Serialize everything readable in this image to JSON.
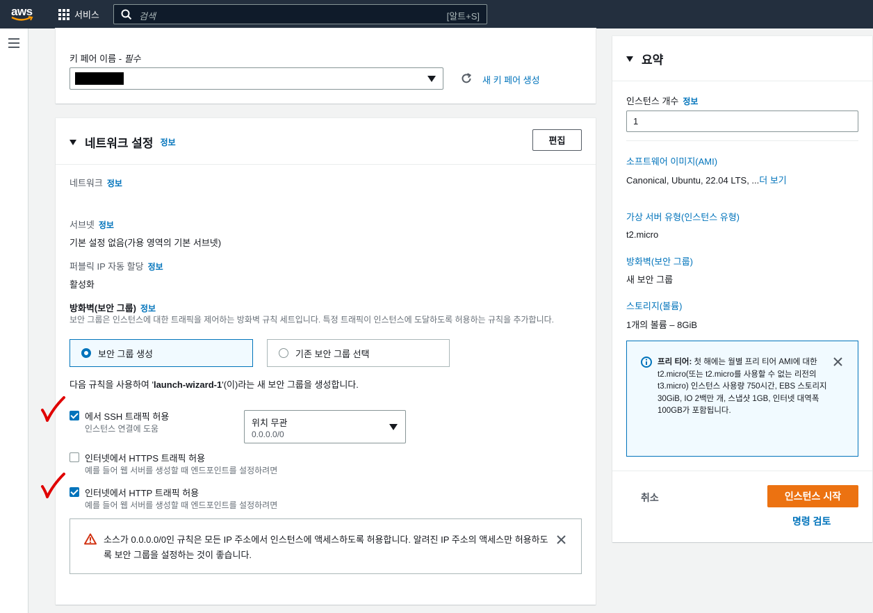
{
  "topbar": {
    "logo_text": "aws",
    "services_label": "서비스",
    "search_placeholder": "검색",
    "search_shortcut": "[알트+S]"
  },
  "keypair": {
    "label": "키 페어 이름",
    "required": " - 필수",
    "new_link": "새 키 페어 생성"
  },
  "network": {
    "title": "네트워크 설정",
    "info": "정보",
    "edit_button": "편집",
    "network_label": "네트워크",
    "subnet_label": "서브넷",
    "subnet_value": "기본 설정 없음(가용 영역의 기본 서브넷)",
    "public_ip_label": "퍼블릭 IP 자동 할당",
    "public_ip_value": "활성화",
    "firewall_label": "방화벽(보안 그룹)",
    "firewall_desc": "보안 그룹은 인스턴스에 대한 트래픽을 제어하는 방화벽 규칙 세트입니다. 특정 트래픽이 인스턴스에 도달하도록 허용하는 규칙을 추가합니다.",
    "option_create": "보안 그룹 생성",
    "option_existing": "기존 보안 그룹 선택",
    "rule_text_pre": "다음 규칙을 사용하여 '",
    "rule_text_name": "launch-wizard-1",
    "rule_text_post": "'(이)라는 새 보안 그룹을 생성합니다.",
    "ssh_label": "에서 SSH 트래픽 허용",
    "ssh_sub": "인스턴스 연결에 도움",
    "ssh_source_label": "위치 무관",
    "ssh_source_value": "0.0.0.0/0",
    "https_label": "인터넷에서 HTTPS 트래픽 허용",
    "https_sub": "예를 들어 웹 서버를 생성할 때 엔드포인트를 설정하려면",
    "http_label": "인터넷에서 HTTP 트래픽 허용",
    "http_sub": "예를 들어 웹 서버를 생성할 때 엔드포인트를 설정하려면",
    "warning": "소스가 0.0.0.0/0인 규칙은 모든 IP 주소에서 인스턴스에 액세스하도록 허용합니다. 알려진 IP 주소의 액세스만 허용하도록 보안 그룹을 설정하는 것이 좋습니다."
  },
  "checkboxes": {
    "ssh": true,
    "https": false,
    "http": true
  },
  "summary": {
    "title": "요약",
    "instances_label": "인스턴스 개수",
    "info": "정보",
    "instances_value": "1",
    "ami_label": "소프트웨어 이미지(AMI)",
    "ami_value": "Canonical, Ubuntu, 22.04 LTS, ...",
    "ami_more": "더 보기",
    "type_label": "가상 서버 유형(인스턴스 유형)",
    "type_value": "t2.micro",
    "firewall_label": "방화벽(보안 그룹)",
    "firewall_value": "새 보안 그룹",
    "storage_label": "스토리지(볼륨)",
    "storage_value": "1개의 볼륨 – 8GiB",
    "freetier_bold": "프리 티어:",
    "freetier_text": " 첫 해에는 월별 프리 티어 AMI에 대한 t2.micro(또는 t2.micro를 사용할 수 없는 리전의 t3.micro) 인스턴스 사용량 750시간, EBS 스토리지 30GiB, IO 2백만 개, 스냅샷 1GB, 인터넷 대역폭 100GB가 포함됩니다.",
    "cancel": "취소",
    "launch": "인스턴스 시작",
    "review": "명령 검토"
  },
  "colors": {
    "topbar": "#232f3e",
    "link": "#0073bb",
    "orange": "#ec7211",
    "annotation": "#e00000"
  }
}
